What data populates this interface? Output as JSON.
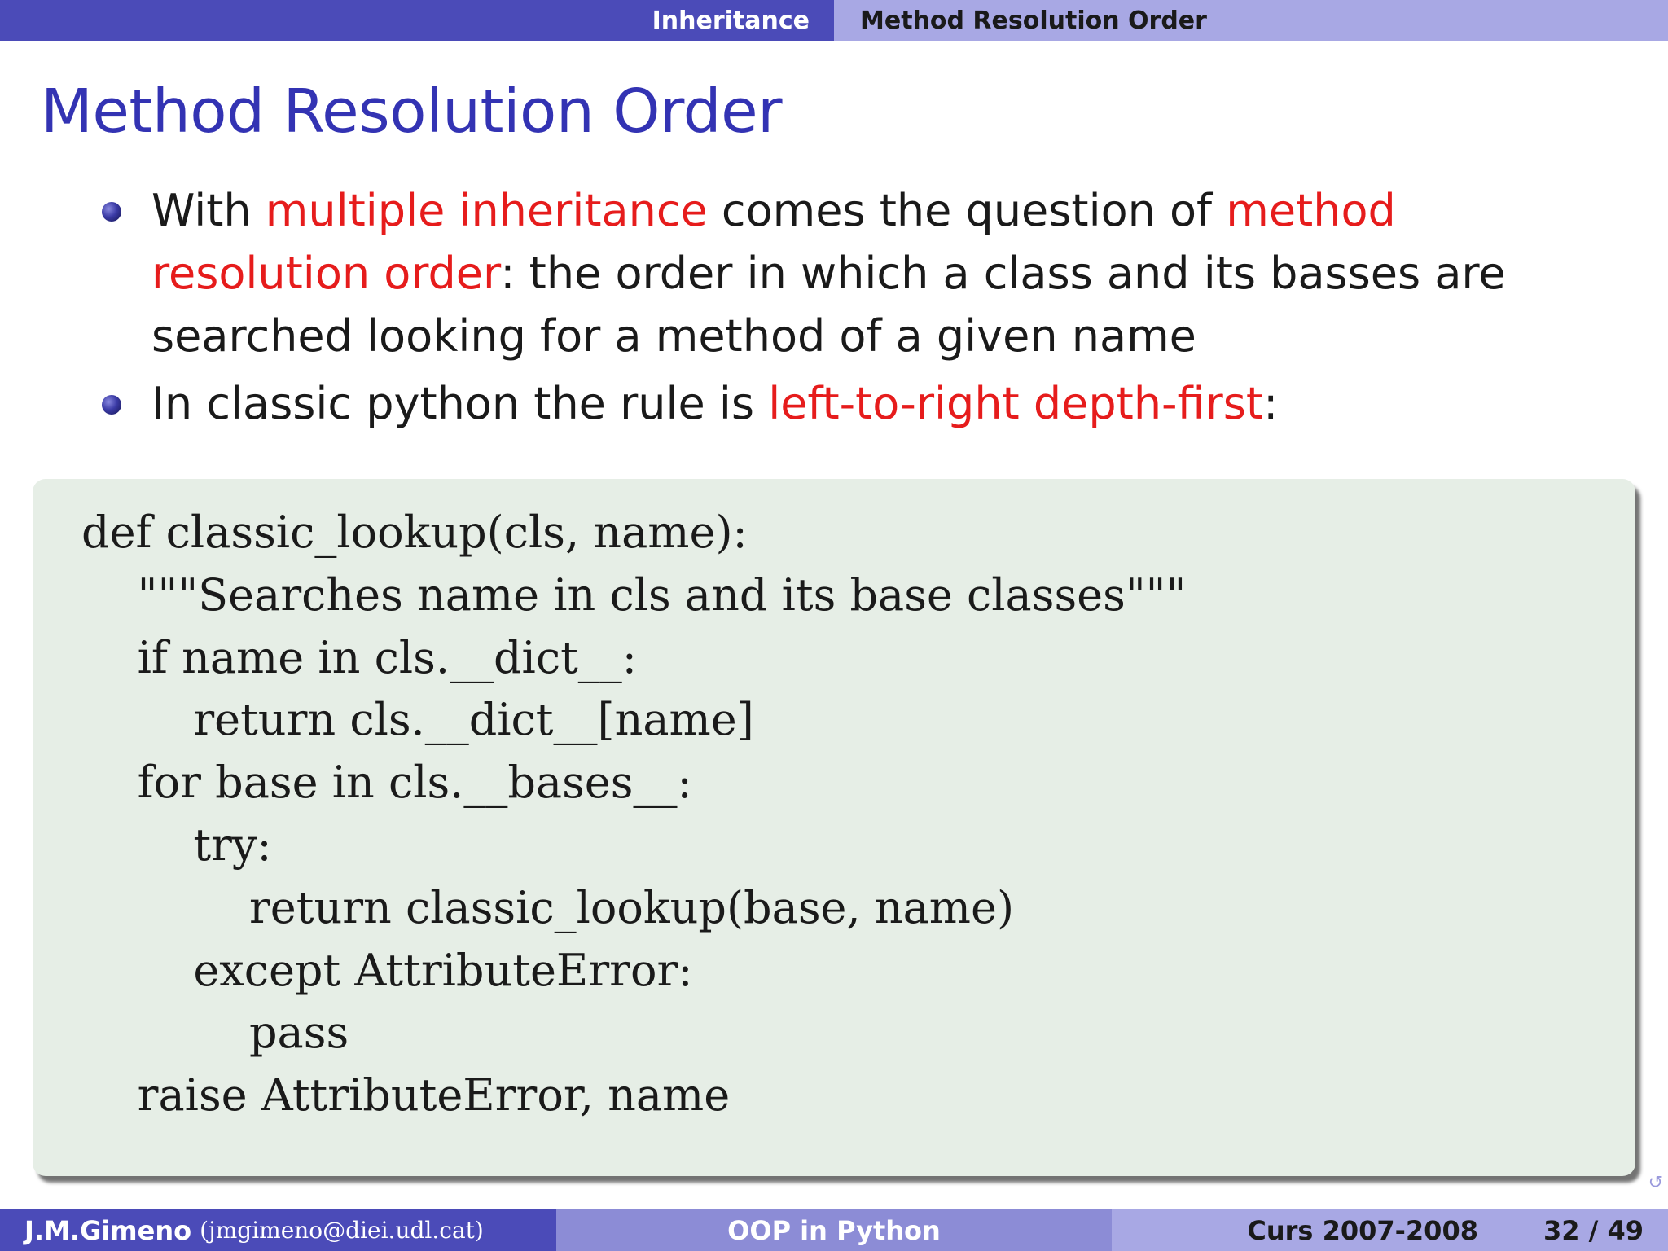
{
  "nav": {
    "section": "Inheritance",
    "subsection": "Method Resolution Order"
  },
  "frame_title": "Method Resolution Order",
  "bullets": [
    {
      "parts": [
        {
          "text": "With ",
          "highlight": false
        },
        {
          "text": "multiple inheritance",
          "highlight": true
        },
        {
          "text": " comes the question of ",
          "highlight": false
        },
        {
          "text": "method resolution order",
          "highlight": true
        },
        {
          "text": ": the order in which a class and its basses are searched looking for a method of a given name",
          "highlight": false
        }
      ]
    },
    {
      "parts": [
        {
          "text": "In classic python the rule is ",
          "highlight": false
        },
        {
          "text": "left-to-right depth-first",
          "highlight": true
        },
        {
          "text": ":",
          "highlight": false
        }
      ]
    }
  ],
  "code_lines": [
    "def classic_lookup(cls, name):",
    "    \"\"\"Searches name in cls and its base classes\"\"\"",
    "    if name in cls.__dict__:",
    "        return cls.__dict__[name]",
    "    for base in cls.__bases__:",
    "        try:",
    "            return classic_lookup(base, name)",
    "        except AttributeError:",
    "            pass",
    "    raise AttributeError, name"
  ],
  "footer": {
    "author": "J.M.Gimeno",
    "email": "(jmgimeno@diei.udl.cat)",
    "title": "OOP in Python",
    "course": "Curs 2007-2008",
    "page": "32 / 49"
  },
  "colors": {
    "nav_dark": "#4b4bb8",
    "nav_light": "#a8a8e4",
    "title": "#3333b3",
    "highlight": "#e61c1c",
    "code_bg": "#e6eee6"
  }
}
